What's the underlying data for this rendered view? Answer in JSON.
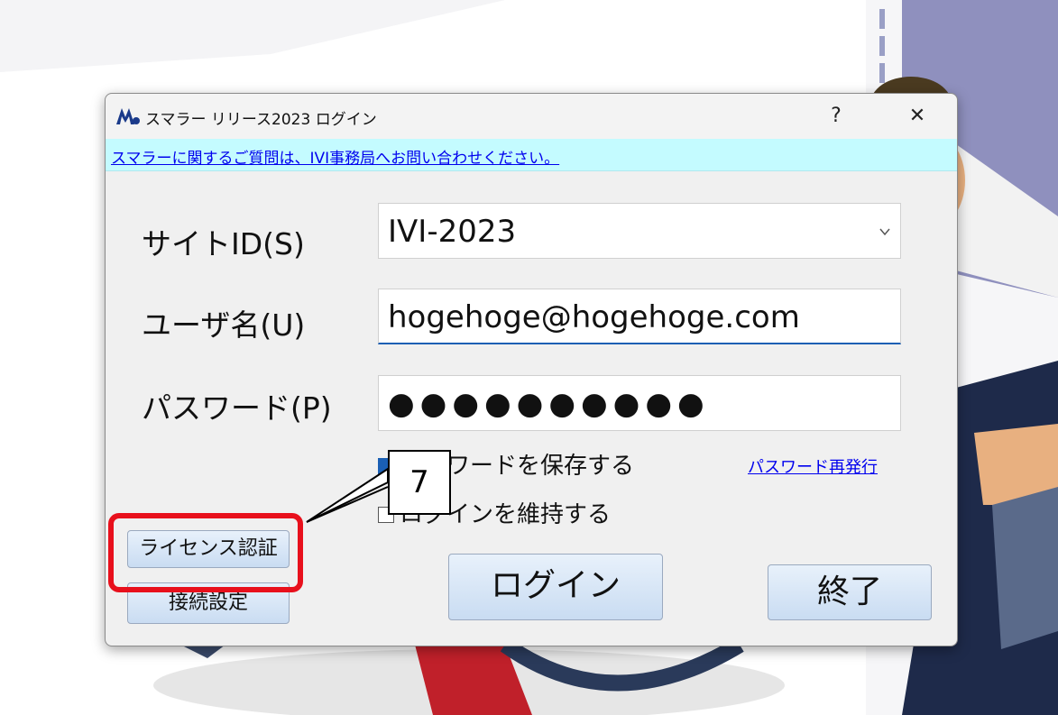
{
  "dialog": {
    "title": "スマラー リリース2023 ログイン",
    "help_label": "?",
    "close_label": "✕",
    "notice_text": "スマラーに関するご質問は、IVI事務局へお問い合わせください。"
  },
  "form": {
    "site_id": {
      "label": "サイトID(S)",
      "value": "IVI-2023"
    },
    "username": {
      "label": "ユーザ名(U)",
      "value": "hogehoge@hogehoge.com"
    },
    "password": {
      "label": "パスワード(P)",
      "value": "●●●●●●●●●●"
    },
    "save_password": {
      "label": "パスワードを保存する",
      "checked": true
    },
    "keep_login": {
      "label": "ログインを維持する",
      "checked": false
    },
    "reissue_link": "パスワード再発行"
  },
  "buttons": {
    "license": "ライセンス認証",
    "connection": "接続設定",
    "login": "ログイン",
    "exit": "終了"
  },
  "annotation": {
    "number": "7"
  },
  "colors": {
    "notice_bg": "#c4fbff",
    "highlight": "#e8101c",
    "link": "#0000ee"
  }
}
